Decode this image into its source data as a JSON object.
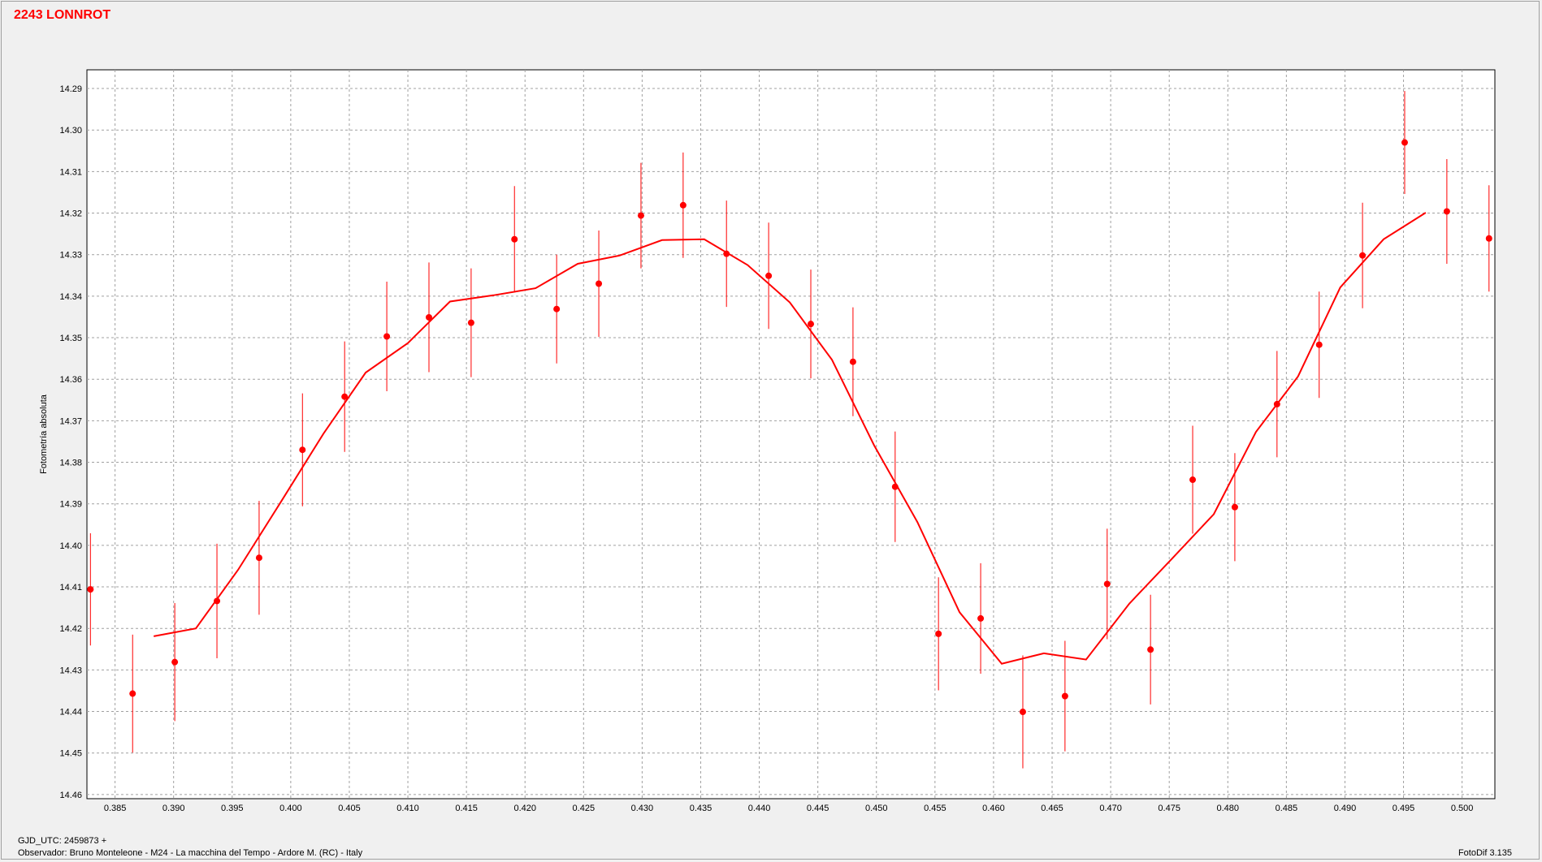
{
  "header": {
    "title": "2243 LONNROT"
  },
  "footer": {
    "gjd": "GJD_UTC: 2459873 +",
    "observer": "Observador: Bruno Monteleone - M24 - La macchina del Tempo - Ardore M. (RC) - Italy",
    "software": "FotoDif 3.135"
  },
  "colors": {
    "series": "#ff0000",
    "grid": "#a0a0a0",
    "plot_bg": "#ffffff",
    "window_bg": "#f0f0f0"
  },
  "chart_data": {
    "type": "scatter",
    "title": "2243 LONNROT",
    "xlabel": "",
    "ylabel": "Fotometría absoluta",
    "xlim": [
      0.3826,
      0.5028
    ],
    "ylim": [
      14.2855,
      14.461
    ],
    "y_inverted": true,
    "grid": true,
    "x_ticks": [
      "0.385",
      "0.390",
      "0.395",
      "0.400",
      "0.405",
      "0.410",
      "0.415",
      "0.420",
      "0.425",
      "0.430",
      "0.435",
      "0.440",
      "0.445",
      "0.450",
      "0.455",
      "0.460",
      "0.465",
      "0.470",
      "0.475",
      "0.480",
      "0.485",
      "0.490",
      "0.495",
      "0.500"
    ],
    "y_ticks": [
      "14.29",
      "14.30",
      "14.31",
      "14.32",
      "14.33",
      "14.34",
      "14.35",
      "14.36",
      "14.37",
      "14.38",
      "14.39",
      "14.40",
      "14.41",
      "14.42",
      "14.43",
      "14.44",
      "14.45",
      "14.46"
    ],
    "series": [
      {
        "type": "scatter_errorbar",
        "x": [
          0.3829,
          0.3865,
          0.3901,
          0.3937,
          0.3973,
          0.401,
          0.4046,
          0.4082,
          0.4118,
          0.4154,
          0.4191,
          0.4227,
          0.4263,
          0.4299,
          0.4335,
          0.4372,
          0.4408,
          0.4444,
          0.448,
          0.4516,
          0.4553,
          0.4589,
          0.4625,
          0.4661,
          0.4697,
          0.4734,
          0.477,
          0.4806,
          0.4842,
          0.4878,
          0.4915,
          0.4951,
          0.4987,
          0.5023
        ],
        "y": [
          14.4106,
          14.4357,
          14.4281,
          14.4134,
          14.403,
          14.377,
          14.3642,
          14.3497,
          14.3451,
          14.3464,
          14.3263,
          14.3431,
          14.337,
          14.3206,
          14.3181,
          14.3298,
          14.3351,
          14.3467,
          14.3558,
          14.3859,
          14.4213,
          14.4176,
          14.4401,
          14.4363,
          14.4093,
          14.4251,
          14.3842,
          14.3908,
          14.366,
          14.3517,
          14.3302,
          14.303,
          14.3196,
          14.3261
        ],
        "err": [
          0.0135,
          0.0142,
          0.0142,
          0.0138,
          0.0137,
          0.0136,
          0.0133,
          0.0132,
          0.0132,
          0.0131,
          0.0128,
          0.0131,
          0.0128,
          0.0127,
          0.0127,
          0.0128,
          0.0128,
          0.0131,
          0.0131,
          0.0133,
          0.0136,
          0.0133,
          0.0136,
          0.0133,
          0.0133,
          0.0132,
          0.013,
          0.013,
          0.0128,
          0.0128,
          0.0127,
          0.0124,
          0.0126,
          0.0128
        ]
      },
      {
        "type": "line",
        "x": [
          0.3883,
          0.3919,
          0.3955,
          0.3991,
          0.4028,
          0.4064,
          0.41,
          0.4136,
          0.4173,
          0.4209,
          0.4245,
          0.4281,
          0.4317,
          0.4353,
          0.439,
          0.4426,
          0.4462,
          0.4498,
          0.4535,
          0.4571,
          0.4607,
          0.4643,
          0.4679,
          0.4716,
          0.4752,
          0.4788,
          0.4824,
          0.486,
          0.4896,
          0.4933,
          0.4969
        ],
        "y": [
          14.4219,
          14.42,
          14.4059,
          14.3898,
          14.3731,
          14.3584,
          14.3513,
          14.3413,
          14.3398,
          14.3381,
          14.3322,
          14.3302,
          14.3265,
          14.3263,
          14.3325,
          14.3415,
          14.3553,
          14.3759,
          14.3944,
          14.4161,
          14.4285,
          14.426,
          14.4275,
          14.414,
          14.4033,
          14.3925,
          14.3727,
          14.3593,
          14.3379,
          14.3263,
          14.3199
        ]
      }
    ]
  }
}
